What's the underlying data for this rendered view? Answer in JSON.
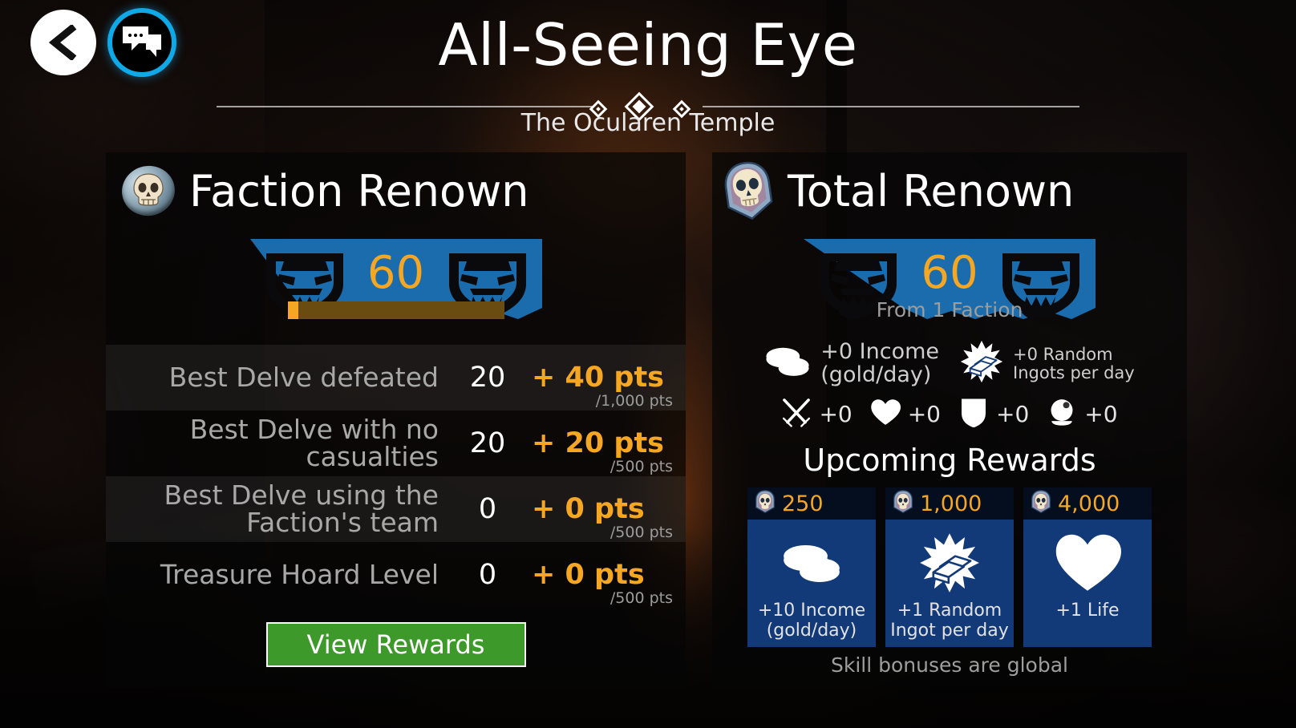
{
  "header": {
    "title": "All-Seeing Eye",
    "subtitle": "The Ocularen Temple",
    "back_label": "Back",
    "chat_label": "Chat"
  },
  "faction_panel": {
    "title": "Faction Renown",
    "renown_value": "60",
    "progress_percent": 5,
    "stats": [
      {
        "label": "Best Delve defeated",
        "value": "20",
        "points": "+ 40 pts",
        "max": "/1,000 pts"
      },
      {
        "label": "Best Delve with no casualties",
        "value": "20",
        "points": "+ 20 pts",
        "max": "/500 pts"
      },
      {
        "label": "Best Delve using the Faction's team",
        "value": "0",
        "points": "+ 0 pts",
        "max": "/500 pts"
      },
      {
        "label": "Treasure Hoard Level",
        "value": "0",
        "points": "+ 0 pts",
        "max": "/500 pts"
      }
    ],
    "view_rewards_label": "View Rewards"
  },
  "total_panel": {
    "title": "Total Renown",
    "renown_value": "60",
    "renown_source": "From 1 Faction",
    "big_bonuses": [
      {
        "icon": "coins-icon",
        "text": "+0 Income\n(gold/day)"
      },
      {
        "icon": "ingot-icon",
        "text": "+0 Random\nIngots per day"
      }
    ],
    "small_bonuses": [
      {
        "icon": "crossed-swords-icon",
        "value": "+0"
      },
      {
        "icon": "heart-icon",
        "value": "+0"
      },
      {
        "icon": "shield-icon",
        "value": "+0"
      },
      {
        "icon": "crystal-ball-icon",
        "value": "+0"
      }
    ],
    "upcoming_title": "Upcoming Rewards",
    "rewards": [
      {
        "cost": "250",
        "icon": "coins-icon",
        "text": "+10 Income\n(gold/day)"
      },
      {
        "cost": "1,000",
        "icon": "ingot-icon",
        "text": "+1 Random\nIngot per day"
      },
      {
        "cost": "4,000",
        "icon": "heart-icon",
        "text": "+1 Life"
      }
    ],
    "global_note": "Skill bonuses are global"
  },
  "colors": {
    "accent_gold": "#f5a623",
    "banner_blue": "#1a6cac",
    "card_blue": "#123a78",
    "button_green": "#3d9a2a",
    "chat_ring_blue": "#0fa9e8"
  }
}
